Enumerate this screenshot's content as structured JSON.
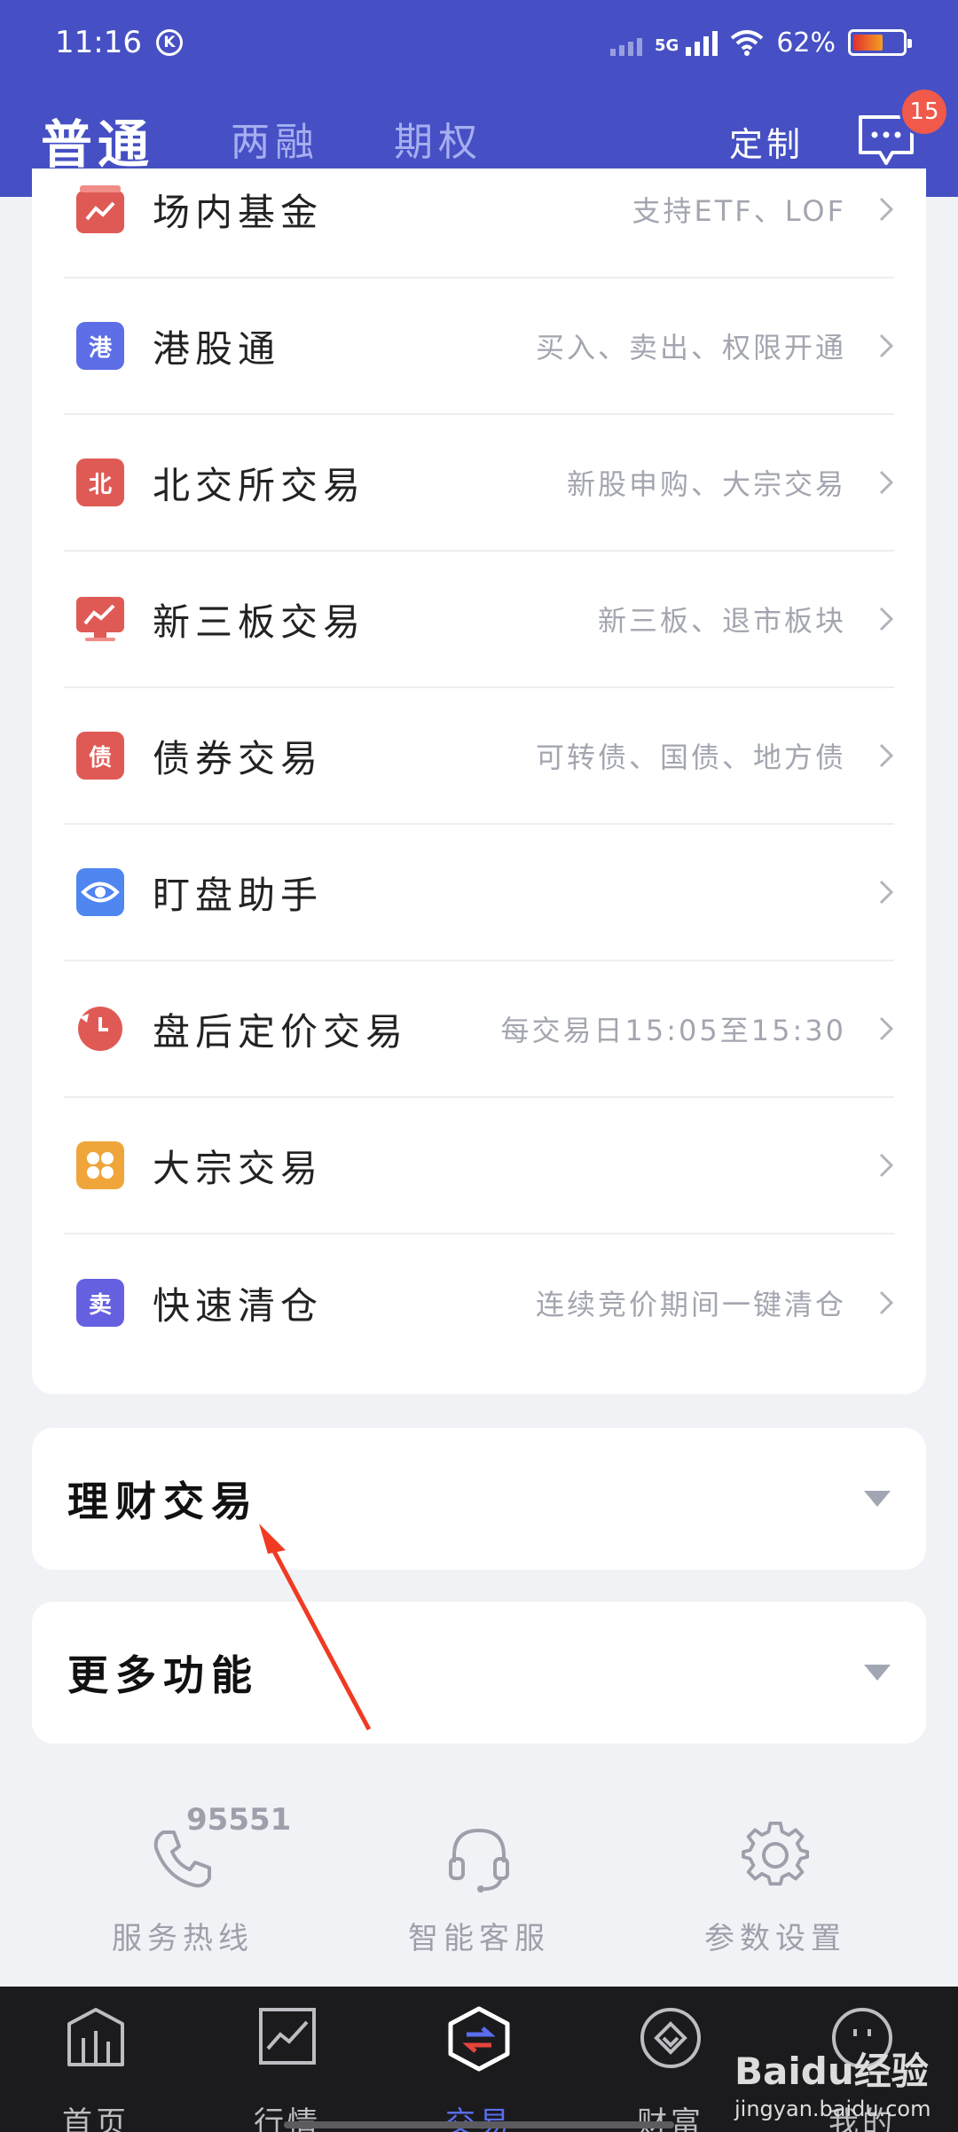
{
  "status_bar": {
    "time": "11:16",
    "k_badge": "K",
    "network": "5G",
    "battery": "62%",
    "battery_level": 0.62
  },
  "header": {
    "tabs": [
      {
        "label": "普通",
        "active": true
      },
      {
        "label": "两融",
        "active": false
      },
      {
        "label": "期权",
        "active": false
      }
    ],
    "customize_label": "定制",
    "message_badge": "15",
    "accent_color": "#4650c4"
  },
  "list": [
    {
      "title": "场内基金",
      "desc": "支持ETF、LOF",
      "icon": "fund-chart-icon",
      "icon_text": "",
      "color": "#e05a55"
    },
    {
      "title": "港股通",
      "desc": "买入、卖出、权限开通",
      "icon": "hk-connect-icon",
      "icon_text": "港",
      "color": "#5d6ee6"
    },
    {
      "title": "北交所交易",
      "desc": "新股申购、大宗交易",
      "icon": "bse-icon",
      "icon_text": "北",
      "color": "#e05a55"
    },
    {
      "title": "新三板交易",
      "desc": "新三板、退市板块",
      "icon": "neeq-trend-icon",
      "icon_text": "",
      "color": "#e05a55"
    },
    {
      "title": "债券交易",
      "desc": "可转债、国债、地方债",
      "icon": "bond-icon",
      "icon_text": "债",
      "color": "#e05a55"
    },
    {
      "title": "盯盘助手",
      "desc": "",
      "icon": "eye-icon",
      "icon_text": "",
      "color": "#4f86f0"
    },
    {
      "title": "盘后定价交易",
      "desc": "每交易日15:05至15:30",
      "icon": "clock-icon",
      "icon_text": "",
      "color": "#e05a55"
    },
    {
      "title": "大宗交易",
      "desc": "",
      "icon": "block-trade-icon",
      "icon_text": "",
      "color": "#f0a53a"
    },
    {
      "title": "快速清仓",
      "desc": "连续竞价期间一键清仓",
      "icon": "quick-sell-icon",
      "icon_text": "卖",
      "color": "#6560e0"
    }
  ],
  "sections": [
    {
      "title": "理财交易"
    },
    {
      "title": "更多功能"
    }
  ],
  "services": {
    "hotline_number": "95551",
    "items": [
      {
        "label": "服务热线",
        "icon": "phone-icon"
      },
      {
        "label": "智能客服",
        "icon": "headset-icon"
      },
      {
        "label": "参数设置",
        "icon": "gear-icon"
      }
    ]
  },
  "tabbar": {
    "items": [
      {
        "label": "首页",
        "icon": "home-chart-icon",
        "active": false
      },
      {
        "label": "行情",
        "icon": "market-icon",
        "active": false
      },
      {
        "label": "交易",
        "icon": "trade-icon",
        "active": true
      },
      {
        "label": "财富",
        "icon": "wealth-icon",
        "active": false
      },
      {
        "label": "我的",
        "icon": "profile-icon",
        "active": false
      }
    ]
  },
  "watermark": {
    "text": "Baidu经验",
    "url": "jingyan.baidu.com"
  }
}
